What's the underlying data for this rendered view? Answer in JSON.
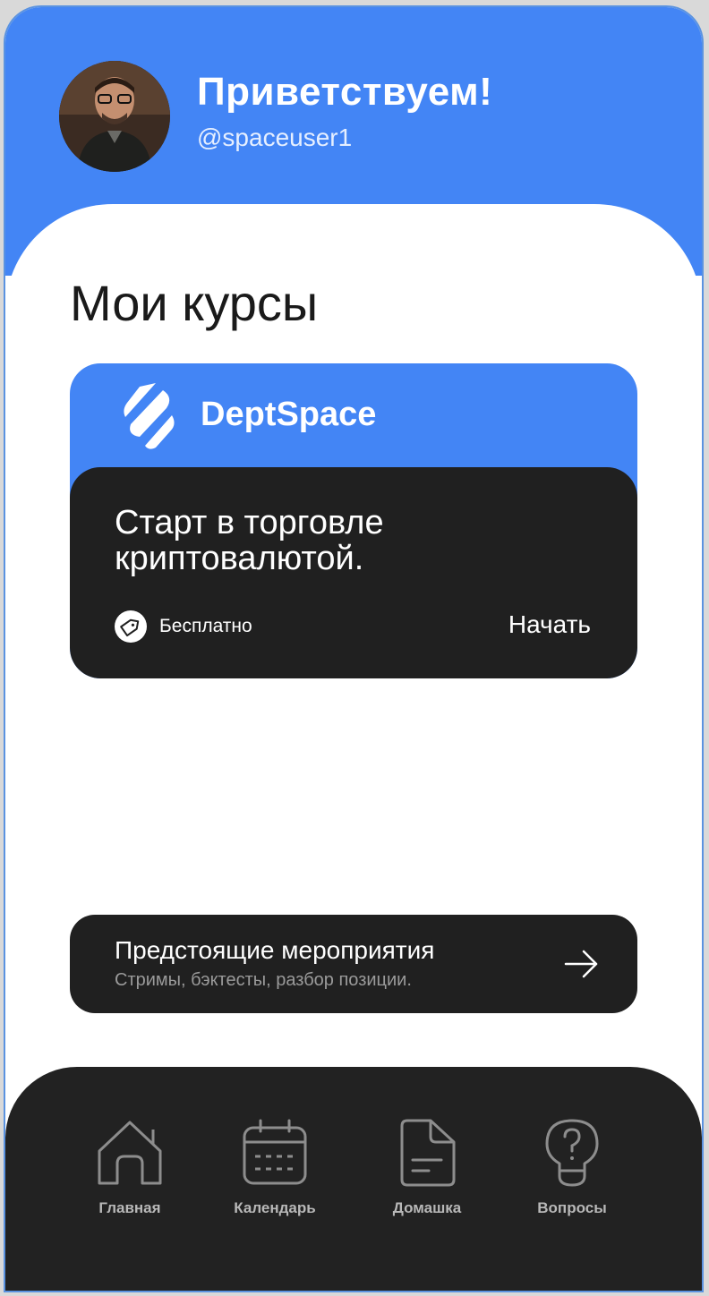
{
  "header": {
    "greeting": "Приветствуем!",
    "username": "@spaceuser1",
    "avatar_icon": "user-photo",
    "background_color": "#4385f5"
  },
  "courses_section": {
    "title": "Мои курсы"
  },
  "course_card": {
    "brand_name": "DeptSpace",
    "brand_icon": "deptspace-logo",
    "title": "Старт в торговле криптовалютой.",
    "price_icon": "price-tag-icon",
    "price_label": "Бесплатно",
    "action_label": "Начать"
  },
  "events_card": {
    "title": "Предстоящие мероприятия",
    "subtitle": "Стримы, бэктесты, разбор позиции.",
    "arrow_icon": "arrow-right-icon"
  },
  "nav": {
    "items": [
      {
        "label": "Главная",
        "icon": "home-icon"
      },
      {
        "label": "Календарь",
        "icon": "calendar-icon"
      },
      {
        "label": "Домашка",
        "icon": "document-icon"
      },
      {
        "label": "Вопросы",
        "icon": "lightbulb-question-icon"
      }
    ]
  },
  "colors": {
    "accent": "#4385f5",
    "dark_card": "#202020",
    "nav_background": "#222222"
  }
}
